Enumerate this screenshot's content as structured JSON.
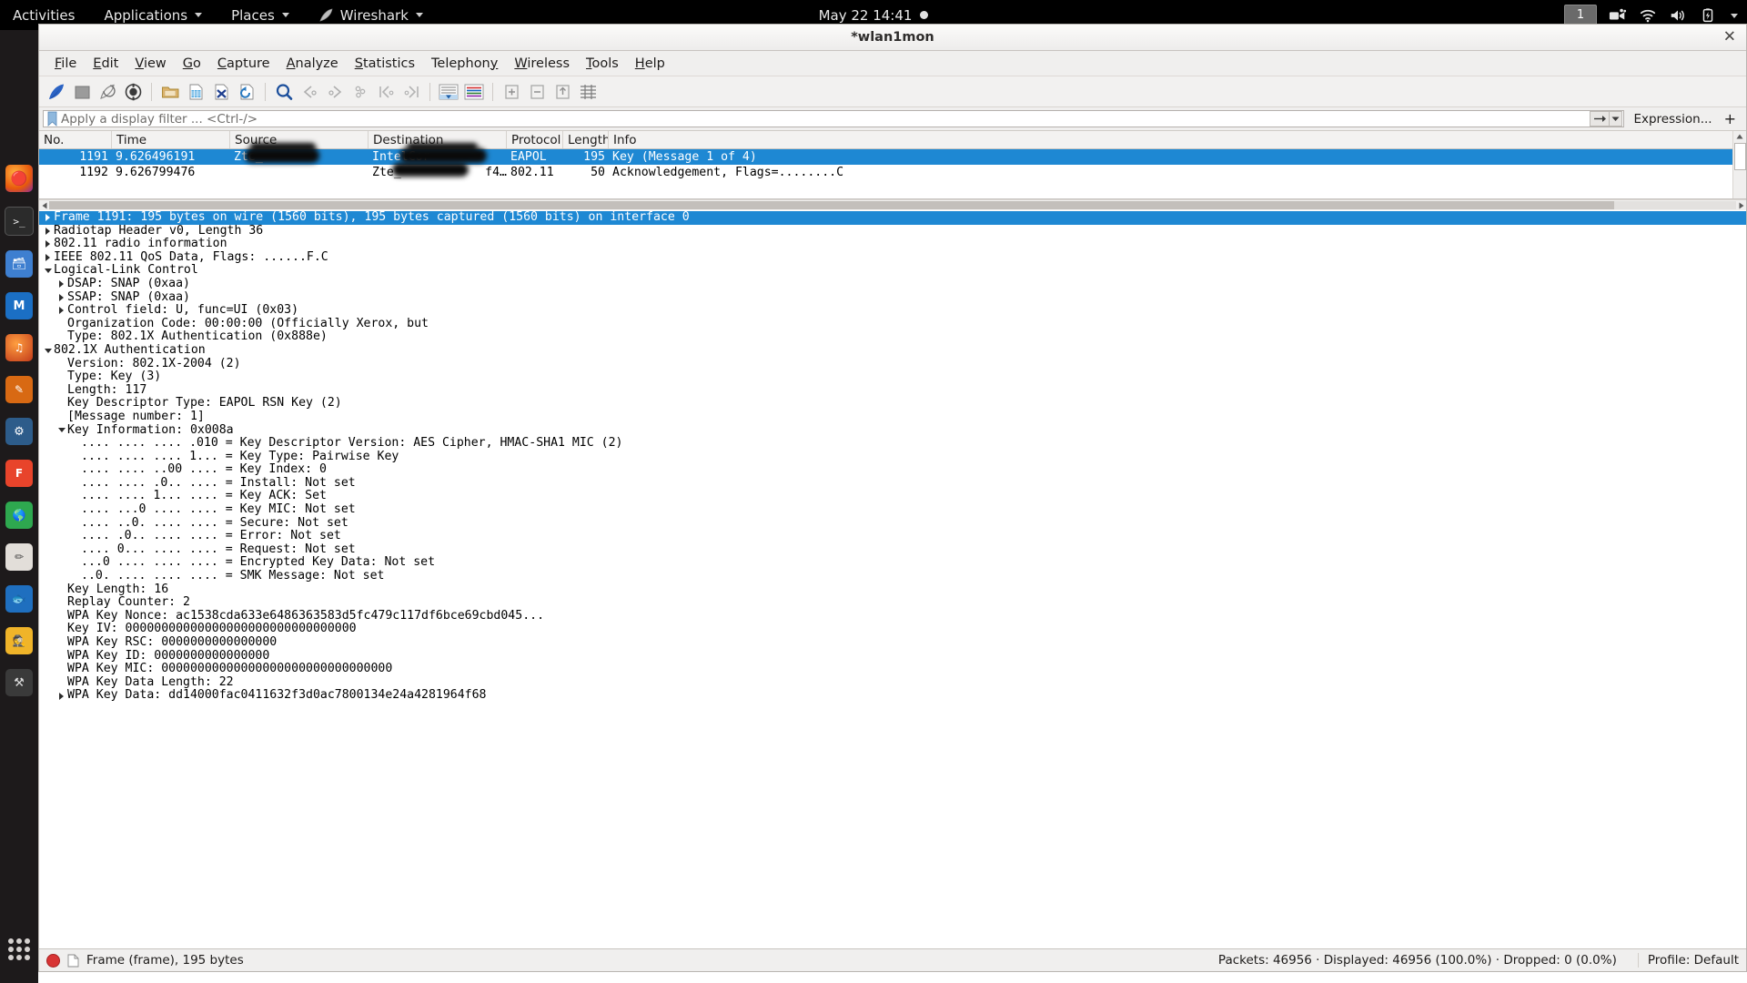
{
  "gnome": {
    "activities": "Activities",
    "applications": "Applications",
    "places": "Places",
    "app_name": "Wireshark",
    "clock": "May 22 14:41",
    "workspace": "1"
  },
  "window": {
    "title": "*wlan1mon",
    "close_glyph": "✕"
  },
  "menubar": [
    {
      "label": "File",
      "mnemonic": "F"
    },
    {
      "label": "Edit",
      "mnemonic": "E"
    },
    {
      "label": "View",
      "mnemonic": "V"
    },
    {
      "label": "Go",
      "mnemonic": "G"
    },
    {
      "label": "Capture",
      "mnemonic": "C"
    },
    {
      "label": "Analyze",
      "mnemonic": "A"
    },
    {
      "label": "Statistics",
      "mnemonic": "S"
    },
    {
      "label": "Telephony",
      "mnemonic": "y"
    },
    {
      "label": "Wireless",
      "mnemonic": "W"
    },
    {
      "label": "Tools",
      "mnemonic": "T"
    },
    {
      "label": "Help",
      "mnemonic": "H"
    }
  ],
  "toolbar": [
    "start-capture-icon",
    "stop-capture-icon",
    "restart-capture-icon",
    "capture-options-icon",
    "open-file-icon",
    "save-file-icon",
    "close-file-icon",
    "reload-file-icon",
    "find-packet-icon",
    "go-back-icon",
    "go-forward-icon",
    "go-to-packet-icon",
    "go-first-packet-icon",
    "go-last-packet-icon",
    "auto-scroll-icon",
    "colorize-icon",
    "zoom-in-icon",
    "zoom-out-icon",
    "zoom-reset-icon",
    "resize-columns-icon"
  ],
  "filter": {
    "placeholder": "Apply a display filter ... <Ctrl-/>",
    "value": "",
    "expression_label": "Expression...",
    "plus_label": "+"
  },
  "packet_list": {
    "columns": [
      "No.",
      "Time",
      "Source",
      "Destination",
      "Protocol",
      "Length",
      "Info"
    ],
    "rows": [
      {
        "no": "1191",
        "time": "9.626496191",
        "source": "Zte_",
        "destination": "IntelCor",
        "protocol": "EAPOL",
        "length": "195",
        "info": "Key (Message 1 of 4)",
        "selected": true
      },
      {
        "no": "1192",
        "time": "9.626799476",
        "source": "",
        "destination": "Zte_",
        "destination_suffix": "f4…",
        "protocol": "802.11",
        "length": "50",
        "info": "Acknowledgement, Flags=........C",
        "selected": false
      }
    ]
  },
  "details": [
    {
      "indent": 0,
      "twisty": "right",
      "selected": true,
      "text": "Frame 1191: 195 bytes on wire (1560 bits), 195 bytes captured (1560 bits) on interface 0"
    },
    {
      "indent": 0,
      "twisty": "right",
      "selected": false,
      "text": "Radiotap Header v0, Length 36"
    },
    {
      "indent": 0,
      "twisty": "right",
      "selected": false,
      "text": "802.11 radio information"
    },
    {
      "indent": 0,
      "twisty": "right",
      "selected": false,
      "text": "IEEE 802.11 QoS Data, Flags: ......F.C"
    },
    {
      "indent": 0,
      "twisty": "down",
      "selected": false,
      "text": "Logical-Link Control"
    },
    {
      "indent": 1,
      "twisty": "right",
      "selected": false,
      "text": "DSAP: SNAP (0xaa)"
    },
    {
      "indent": 1,
      "twisty": "right",
      "selected": false,
      "text": "SSAP: SNAP (0xaa)"
    },
    {
      "indent": 1,
      "twisty": "right",
      "selected": false,
      "text": "Control field: U, func=UI (0x03)"
    },
    {
      "indent": 1,
      "twisty": "none",
      "selected": false,
      "text": "Organization Code: 00:00:00 (Officially Xerox, but"
    },
    {
      "indent": 1,
      "twisty": "none",
      "selected": false,
      "text": "Type: 802.1X Authentication (0x888e)"
    },
    {
      "indent": 0,
      "twisty": "down",
      "selected": false,
      "text": "802.1X Authentication"
    },
    {
      "indent": 1,
      "twisty": "none",
      "selected": false,
      "text": "Version: 802.1X-2004 (2)"
    },
    {
      "indent": 1,
      "twisty": "none",
      "selected": false,
      "text": "Type: Key (3)"
    },
    {
      "indent": 1,
      "twisty": "none",
      "selected": false,
      "text": "Length: 117"
    },
    {
      "indent": 1,
      "twisty": "none",
      "selected": false,
      "text": "Key Descriptor Type: EAPOL RSN Key (2)"
    },
    {
      "indent": 1,
      "twisty": "none",
      "selected": false,
      "text": "[Message number: 1]"
    },
    {
      "indent": 1,
      "twisty": "down",
      "selected": false,
      "text": "Key Information: 0x008a"
    },
    {
      "indent": 2,
      "twisty": "none",
      "selected": false,
      "text": ".... .... .... .010 = Key Descriptor Version: AES Cipher, HMAC-SHA1 MIC (2)"
    },
    {
      "indent": 2,
      "twisty": "none",
      "selected": false,
      "text": ".... .... .... 1... = Key Type: Pairwise Key"
    },
    {
      "indent": 2,
      "twisty": "none",
      "selected": false,
      "text": ".... .... ..00 .... = Key Index: 0"
    },
    {
      "indent": 2,
      "twisty": "none",
      "selected": false,
      "text": ".... .... .0.. .... = Install: Not set"
    },
    {
      "indent": 2,
      "twisty": "none",
      "selected": false,
      "text": ".... .... 1... .... = Key ACK: Set"
    },
    {
      "indent": 2,
      "twisty": "none",
      "selected": false,
      "text": ".... ...0 .... .... = Key MIC: Not set"
    },
    {
      "indent": 2,
      "twisty": "none",
      "selected": false,
      "text": ".... ..0. .... .... = Secure: Not set"
    },
    {
      "indent": 2,
      "twisty": "none",
      "selected": false,
      "text": ".... .0.. .... .... = Error: Not set"
    },
    {
      "indent": 2,
      "twisty": "none",
      "selected": false,
      "text": ".... 0... .... .... = Request: Not set"
    },
    {
      "indent": 2,
      "twisty": "none",
      "selected": false,
      "text": "...0 .... .... .... = Encrypted Key Data: Not set"
    },
    {
      "indent": 2,
      "twisty": "none",
      "selected": false,
      "text": "..0. .... .... .... = SMK Message: Not set"
    },
    {
      "indent": 1,
      "twisty": "none",
      "selected": false,
      "text": "Key Length: 16"
    },
    {
      "indent": 1,
      "twisty": "none",
      "selected": false,
      "text": "Replay Counter: 2"
    },
    {
      "indent": 1,
      "twisty": "none",
      "selected": false,
      "text": "WPA Key Nonce: ac1538cda633e6486363583d5fc479c117df6bce69cbd045..."
    },
    {
      "indent": 1,
      "twisty": "none",
      "selected": false,
      "text": "Key IV: 00000000000000000000000000000000"
    },
    {
      "indent": 1,
      "twisty": "none",
      "selected": false,
      "text": "WPA Key RSC: 0000000000000000"
    },
    {
      "indent": 1,
      "twisty": "none",
      "selected": false,
      "text": "WPA Key ID: 0000000000000000"
    },
    {
      "indent": 1,
      "twisty": "none",
      "selected": false,
      "text": "WPA Key MIC: 00000000000000000000000000000000"
    },
    {
      "indent": 1,
      "twisty": "none",
      "selected": false,
      "text": "WPA Key Data Length: 22"
    },
    {
      "indent": 1,
      "twisty": "right",
      "selected": false,
      "text": "WPA Key Data: dd14000fac0411632f3d0ac7800134e24a4281964f68"
    }
  ],
  "statusbar": {
    "left": "Frame (frame), 195 bytes",
    "middle": "Packets: 46956 · Displayed: 46956 (100.0%) · Dropped: 0 (0.0%)",
    "right": "Profile: Default"
  },
  "colors": {
    "selection_blue": "#1e88d3",
    "record_red": "#d83434",
    "titlebar": "#f6f5f4"
  }
}
